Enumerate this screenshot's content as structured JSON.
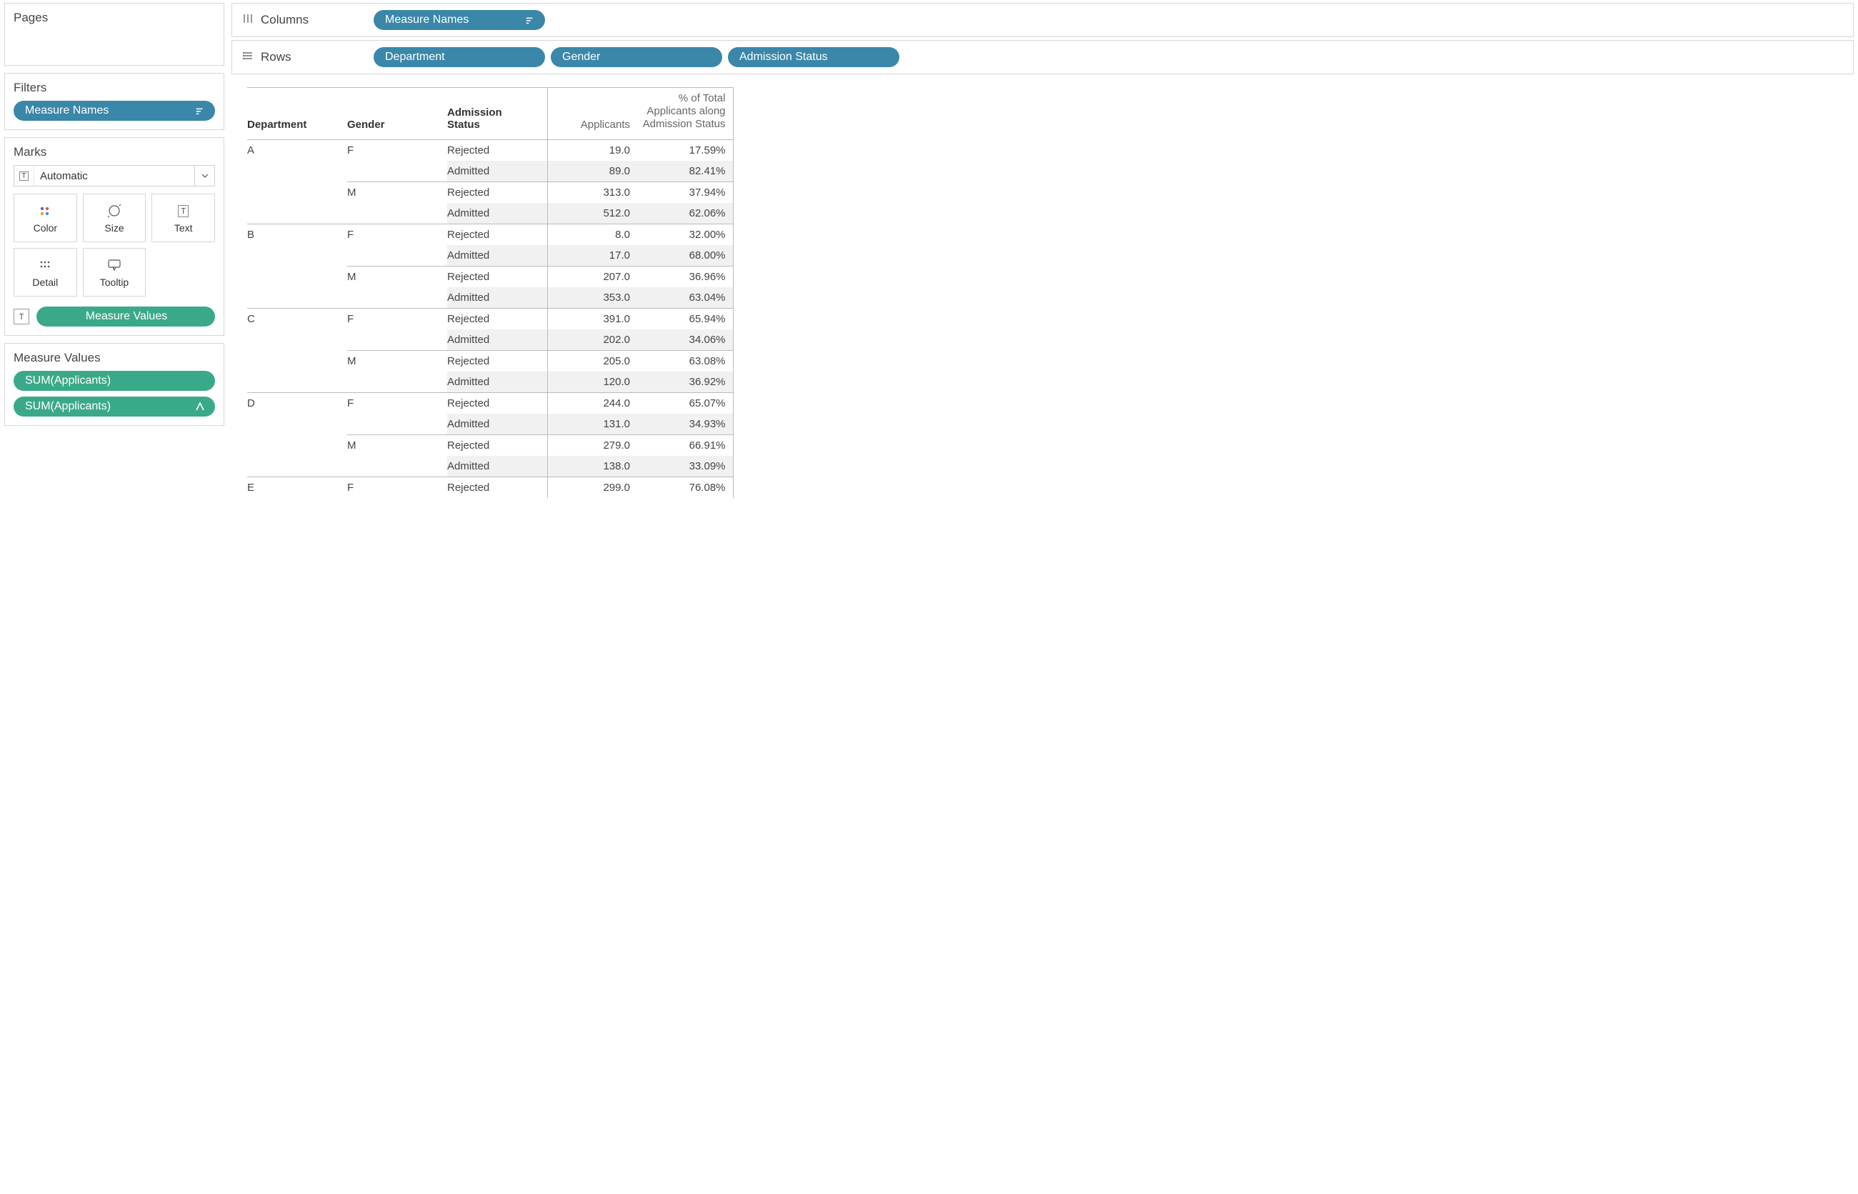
{
  "sidebar": {
    "pages_title": "Pages",
    "filters_title": "Filters",
    "filter_pill": "Measure Names",
    "marks_title": "Marks",
    "marks_dropdown": "Automatic",
    "mark_buttons": {
      "color": "Color",
      "size": "Size",
      "text": "Text",
      "detail": "Detail",
      "tooltip": "Tooltip"
    },
    "marks_drop_pill": "Measure Values",
    "mv_title": "Measure Values",
    "mv_items": [
      "SUM(Applicants)",
      "SUM(Applicants)"
    ]
  },
  "shelves": {
    "columns_label": "Columns",
    "rows_label": "Rows",
    "columns_pills": [
      "Measure Names"
    ],
    "rows_pills": [
      "Department",
      "Gender",
      "Admission Status"
    ]
  },
  "table": {
    "headers": {
      "department": "Department",
      "gender": "Gender",
      "status": "Admission Status",
      "applicants": "Applicants",
      "pct": "% of Total Applicants along Admission Status"
    },
    "rows": [
      {
        "dept": "A",
        "gender": "F",
        "status": "Rejected",
        "app": "19.0",
        "pct": "17.59%",
        "deptStart": true,
        "genderStart": true
      },
      {
        "dept": "",
        "gender": "",
        "status": "Admitted",
        "app": "89.0",
        "pct": "82.41%",
        "alt": true
      },
      {
        "dept": "",
        "gender": "M",
        "status": "Rejected",
        "app": "313.0",
        "pct": "37.94%",
        "genderStart": true
      },
      {
        "dept": "",
        "gender": "",
        "status": "Admitted",
        "app": "512.0",
        "pct": "62.06%",
        "alt": true
      },
      {
        "dept": "B",
        "gender": "F",
        "status": "Rejected",
        "app": "8.0",
        "pct": "32.00%",
        "deptStart": true,
        "genderStart": true
      },
      {
        "dept": "",
        "gender": "",
        "status": "Admitted",
        "app": "17.0",
        "pct": "68.00%",
        "alt": true
      },
      {
        "dept": "",
        "gender": "M",
        "status": "Rejected",
        "app": "207.0",
        "pct": "36.96%",
        "genderStart": true
      },
      {
        "dept": "",
        "gender": "",
        "status": "Admitted",
        "app": "353.0",
        "pct": "63.04%",
        "alt": true
      },
      {
        "dept": "C",
        "gender": "F",
        "status": "Rejected",
        "app": "391.0",
        "pct": "65.94%",
        "deptStart": true,
        "genderStart": true
      },
      {
        "dept": "",
        "gender": "",
        "status": "Admitted",
        "app": "202.0",
        "pct": "34.06%",
        "alt": true
      },
      {
        "dept": "",
        "gender": "M",
        "status": "Rejected",
        "app": "205.0",
        "pct": "63.08%",
        "genderStart": true
      },
      {
        "dept": "",
        "gender": "",
        "status": "Admitted",
        "app": "120.0",
        "pct": "36.92%",
        "alt": true
      },
      {
        "dept": "D",
        "gender": "F",
        "status": "Rejected",
        "app": "244.0",
        "pct": "65.07%",
        "deptStart": true,
        "genderStart": true
      },
      {
        "dept": "",
        "gender": "",
        "status": "Admitted",
        "app": "131.0",
        "pct": "34.93%",
        "alt": true
      },
      {
        "dept": "",
        "gender": "M",
        "status": "Rejected",
        "app": "279.0",
        "pct": "66.91%",
        "genderStart": true
      },
      {
        "dept": "",
        "gender": "",
        "status": "Admitted",
        "app": "138.0",
        "pct": "33.09%",
        "alt": true
      },
      {
        "dept": "E",
        "gender": "F",
        "status": "Rejected",
        "app": "299.0",
        "pct": "76.08%",
        "deptStart": true,
        "genderStart": true
      }
    ]
  },
  "chart_data": {
    "type": "table",
    "title": "",
    "columns": [
      "Department",
      "Gender",
      "Admission Status",
      "Applicants",
      "% of Total Applicants along Admission Status"
    ],
    "rows": [
      [
        "A",
        "F",
        "Rejected",
        19.0,
        17.59
      ],
      [
        "A",
        "F",
        "Admitted",
        89.0,
        82.41
      ],
      [
        "A",
        "M",
        "Rejected",
        313.0,
        37.94
      ],
      [
        "A",
        "M",
        "Admitted",
        512.0,
        62.06
      ],
      [
        "B",
        "F",
        "Rejected",
        8.0,
        32.0
      ],
      [
        "B",
        "F",
        "Admitted",
        17.0,
        68.0
      ],
      [
        "B",
        "M",
        "Rejected",
        207.0,
        36.96
      ],
      [
        "B",
        "M",
        "Admitted",
        353.0,
        63.04
      ],
      [
        "C",
        "F",
        "Rejected",
        391.0,
        65.94
      ],
      [
        "C",
        "F",
        "Admitted",
        202.0,
        34.06
      ],
      [
        "C",
        "M",
        "Rejected",
        205.0,
        63.08
      ],
      [
        "C",
        "M",
        "Admitted",
        120.0,
        36.92
      ],
      [
        "D",
        "F",
        "Rejected",
        244.0,
        65.07
      ],
      [
        "D",
        "F",
        "Admitted",
        131.0,
        34.93
      ],
      [
        "D",
        "M",
        "Rejected",
        279.0,
        66.91
      ],
      [
        "D",
        "M",
        "Admitted",
        138.0,
        33.09
      ],
      [
        "E",
        "F",
        "Rejected",
        299.0,
        76.08
      ]
    ]
  }
}
